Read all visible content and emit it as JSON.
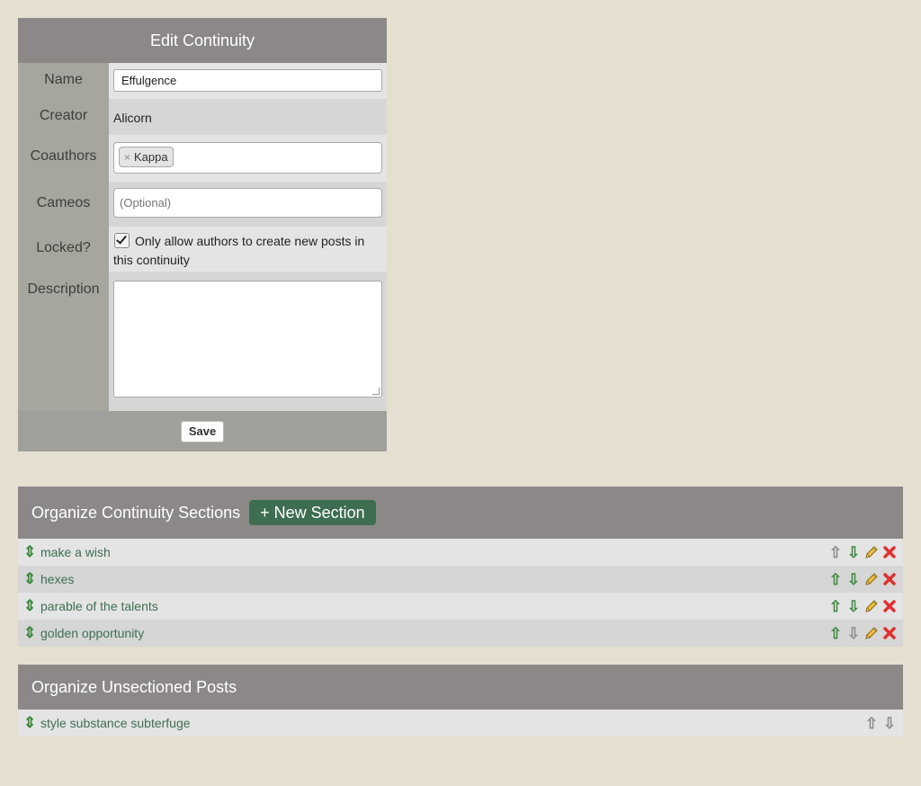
{
  "edit_form": {
    "title": "Edit Continuity",
    "name_label": "Name",
    "name_value": "Effulgence",
    "creator_label": "Creator",
    "creator_value": "Alicorn",
    "coauthors_label": "Coauthors",
    "coauthor_tags": [
      "Kappa"
    ],
    "tag_remove_glyph": "×",
    "cameos_label": "Cameos",
    "cameos_placeholder": "(Optional)",
    "locked_label": "Locked?",
    "locked_checked": true,
    "locked_text": "Only allow authors to create new posts in this continuity",
    "description_label": "Description",
    "description_value": "",
    "save_label": "Save"
  },
  "sections_panel": {
    "title": "Organize Continuity Sections",
    "new_section_label": "+ New Section",
    "items": [
      {
        "name": "make a wish",
        "up_enabled": false,
        "down_enabled": true
      },
      {
        "name": "hexes",
        "up_enabled": true,
        "down_enabled": true
      },
      {
        "name": "parable of the talents",
        "up_enabled": true,
        "down_enabled": true
      },
      {
        "name": "golden opportunity",
        "up_enabled": true,
        "down_enabled": false
      }
    ]
  },
  "unsectioned_panel": {
    "title": "Organize Unsectioned Posts",
    "items": [
      {
        "name": "style substance subterfuge",
        "up_enabled": false,
        "down_enabled": false
      }
    ]
  },
  "icons": {
    "drag": "⇕",
    "up": "⇧",
    "down": "⇩",
    "edit": "pencil-icon",
    "delete": "delete-x-icon"
  },
  "colors": {
    "background": "#e5dfd2",
    "header": "#8c8888",
    "label_column": "#a6a69e",
    "link": "#3e6e52",
    "new_button": "#3e6e52",
    "arrow_enabled": "#3c8a3c",
    "arrow_disabled": "#8c8c8c",
    "delete": "#e03030",
    "pencil": "#e8b830"
  }
}
